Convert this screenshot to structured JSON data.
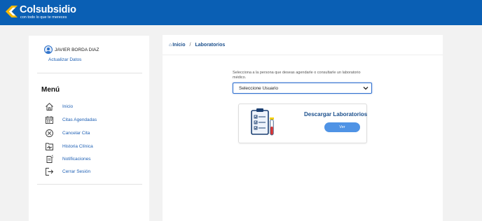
{
  "brand": {
    "name": "Colsubsidio",
    "tagline": "con todo lo que te mereces",
    "color": "#0a5fb4",
    "accent": "#f5b800"
  },
  "user": {
    "name": "JAVIER BORDA DIAZ",
    "update_link": "Actualizar Datos",
    "icon": "user-avatar-icon"
  },
  "menu": {
    "title": "Menú",
    "items": [
      {
        "label": "Inicio",
        "icon": "home-icon"
      },
      {
        "label": "Citas Agendadas",
        "icon": "calendar-icon"
      },
      {
        "label": "Cancelar Cita",
        "icon": "cancel-circle-icon"
      },
      {
        "label": "Historia Clínica",
        "icon": "clinical-history-icon"
      },
      {
        "label": "Notificaciones",
        "icon": "notifications-icon"
      },
      {
        "label": "Cerrar Sesión",
        "icon": "logout-icon"
      }
    ]
  },
  "breadcrumb": {
    "home": "Inicio",
    "separator": "/",
    "current": "Laboratorios"
  },
  "form": {
    "prompt": "Selecciona a la persona que deseas agendarle o consultarle un laboratorio médico.",
    "select_value": "Seleccione Usuario"
  },
  "card": {
    "title": "Descargar Laboratorios",
    "button": "Ver",
    "illustration": "clipboard-test-tubes-illustration"
  },
  "colors": {
    "link": "#1d5fb4",
    "button": "#4f93e5",
    "page_background": "#f2f2f2"
  }
}
